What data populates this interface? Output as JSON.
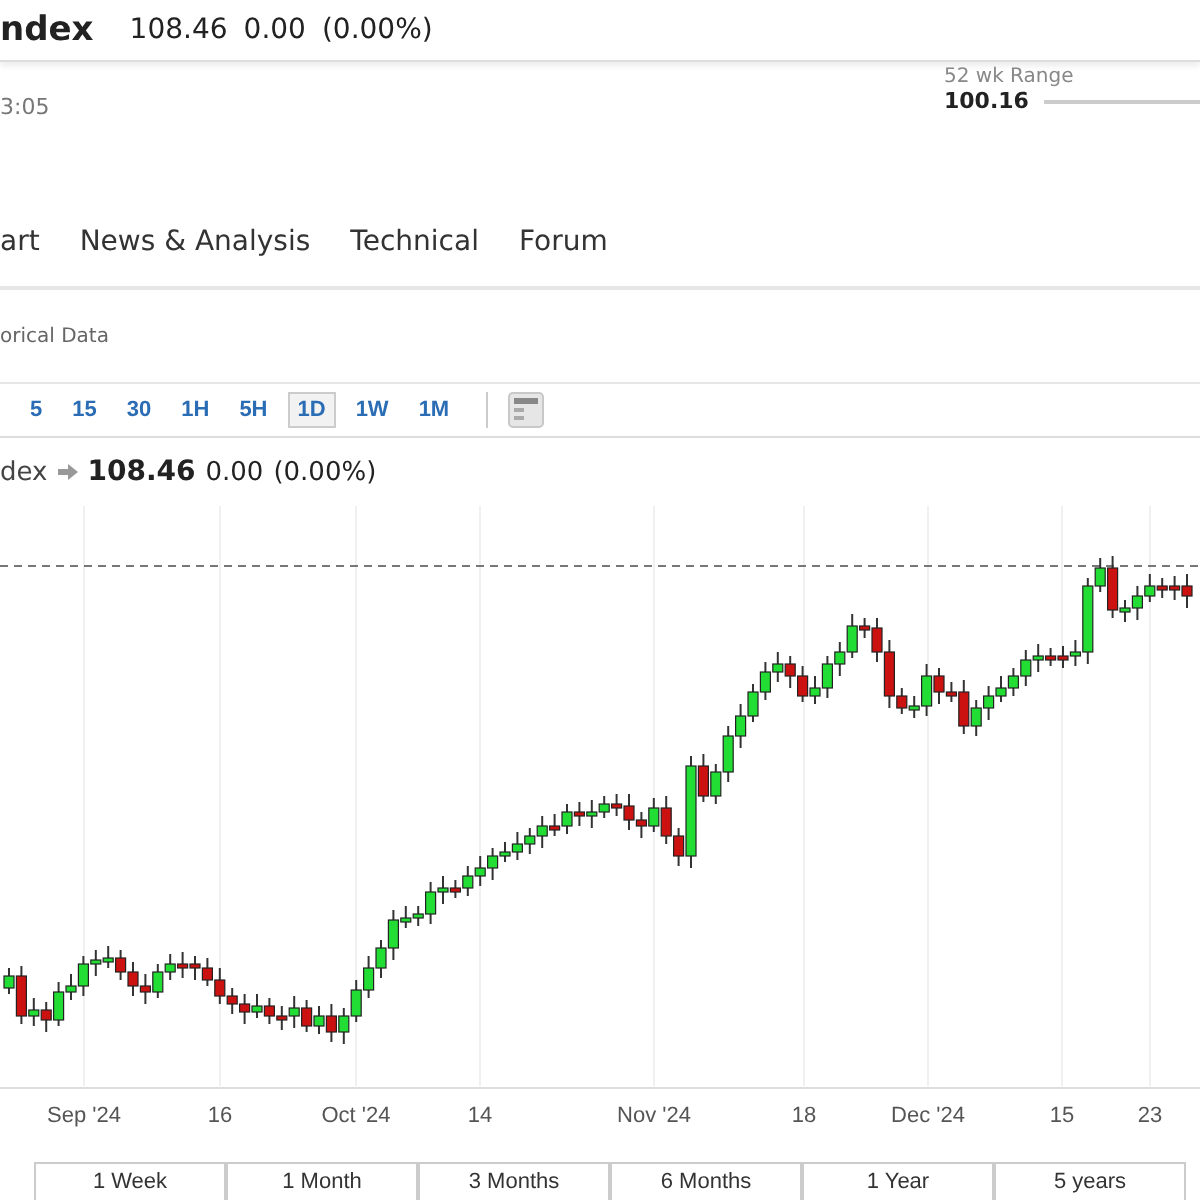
{
  "header": {
    "name": "ndex",
    "price": "108.46",
    "change": "0.00",
    "change_percent": "(0.00%)",
    "time": "3:05",
    "range_label": "52 wk Range",
    "range_low": "100.16"
  },
  "tabs": [
    {
      "label": "art",
      "selected": false
    },
    {
      "label": "News & Analysis",
      "selected": false
    },
    {
      "label": "Technical",
      "selected": false
    },
    {
      "label": "Forum",
      "selected": false
    }
  ],
  "subnav": {
    "label": "orical Data"
  },
  "intervals": [
    {
      "label": "5",
      "selected": false
    },
    {
      "label": "15",
      "selected": false
    },
    {
      "label": "30",
      "selected": false
    },
    {
      "label": "1H",
      "selected": false
    },
    {
      "label": "5H",
      "selected": false
    },
    {
      "label": "1D",
      "selected": true
    },
    {
      "label": "1W",
      "selected": false
    },
    {
      "label": "1M",
      "selected": false
    }
  ],
  "chart_header": {
    "name": "dex",
    "price": "108.46",
    "change": "0.00",
    "change_percent": "(0.00%)"
  },
  "x_axis_labels": [
    "Sep '24",
    "16",
    "Oct '24",
    "14",
    "Nov '24",
    "18",
    "Dec '24",
    "15",
    "23"
  ],
  "periods": [
    {
      "label": "1 Week",
      "selected": false
    },
    {
      "label": "1 Month",
      "selected": false
    },
    {
      "label": "3 Months",
      "selected": false
    },
    {
      "label": "6 Months",
      "selected": false
    },
    {
      "label": "1 Year",
      "selected": false
    },
    {
      "label": "5 years",
      "selected": false
    }
  ]
}
